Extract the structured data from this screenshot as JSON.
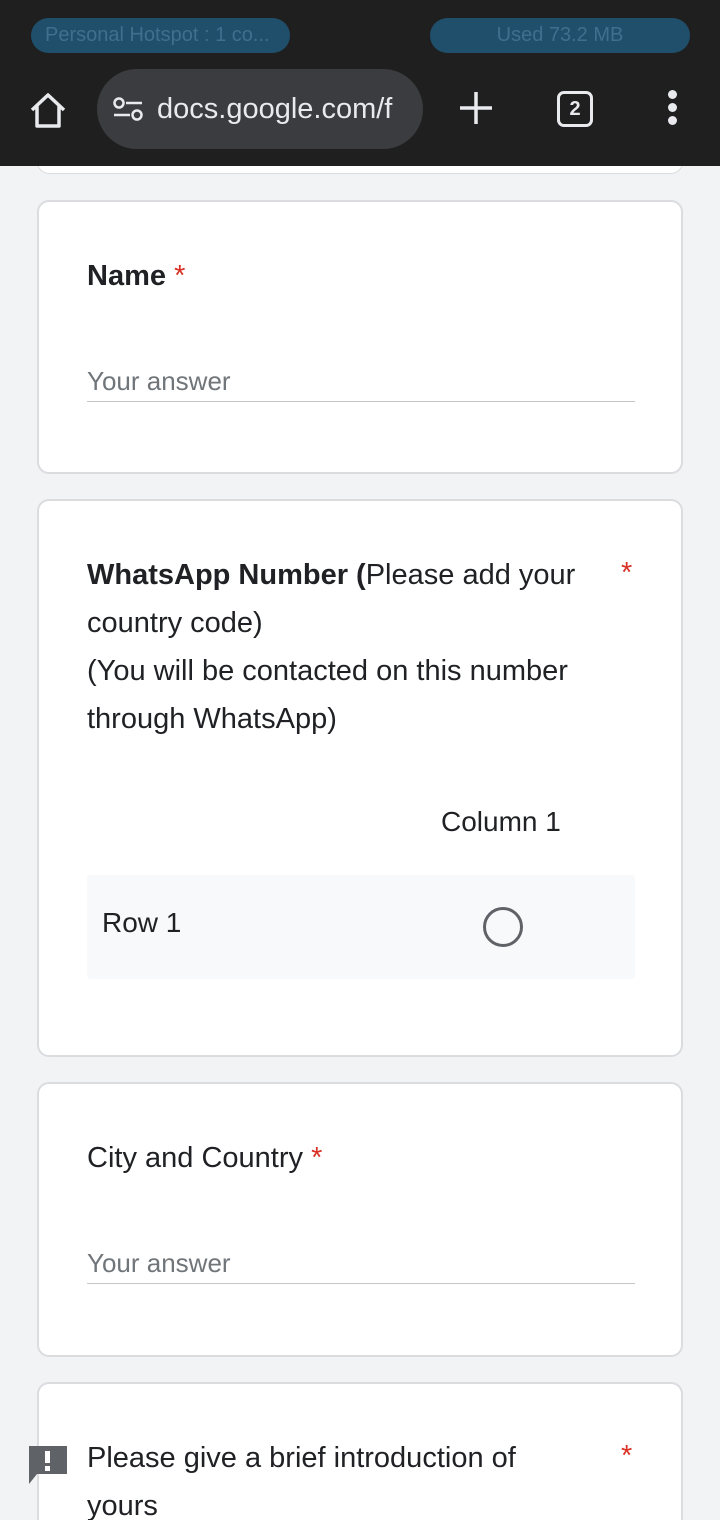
{
  "status_bar": {
    "hotspot": "Personal Hotspot : 1 co...",
    "data_used": "Used  73.2 MB"
  },
  "browser": {
    "url": "docs.google.com/f",
    "tab_count": "2",
    "home_icon": "home-icon",
    "site_settings_icon": "tune-icon",
    "new_tab_icon": "plus-icon",
    "menu_icon": "more-vert-icon"
  },
  "form": {
    "questions": [
      {
        "title": "Name",
        "required": "*",
        "placeholder": "Your answer"
      },
      {
        "title_bold": "WhatsApp Number (",
        "title_rest": "Please add your country code)",
        "title_line3": "(You will be contacted on this number through WhatsApp)",
        "required": "*",
        "grid": {
          "column": "Column 1",
          "row": "Row 1"
        }
      },
      {
        "title": "City and Country",
        "required": "*",
        "placeholder": "Your answer"
      },
      {
        "title": "Please give a brief introduction of yours",
        "required": "*"
      }
    ]
  },
  "colors": {
    "required": "#d93025",
    "toolbar_bg": "#1f1f1f",
    "pill_bg": "#1f4f6b"
  }
}
